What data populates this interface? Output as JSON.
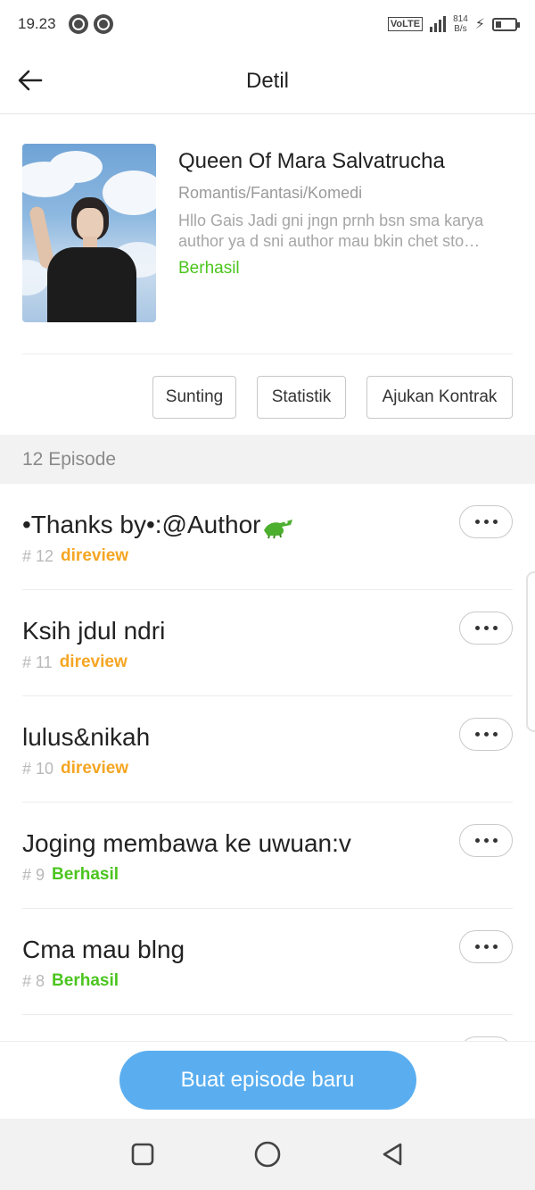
{
  "status_bar": {
    "time": "19.23",
    "network": "VoLTE",
    "network_type": "4G",
    "speed_value": "814",
    "speed_unit": "B/s",
    "icons": [
      "app-notification-icon",
      "chrome-icon",
      "volte-icon",
      "signal-icon",
      "charging-icon",
      "battery-icon"
    ]
  },
  "header": {
    "title": "Detil",
    "back_icon": "arrow-left-icon"
  },
  "book": {
    "title": "Queen Of Mara Salvatrucha",
    "genre": "Romantis/Fantasi/Komedi",
    "description": "Hllo Gais Jadi gni jngn prnh bsn sma karya author ya d sni author mau bkin chet sto…",
    "status": "Berhasil",
    "status_color": "#4cc51f"
  },
  "actions": [
    {
      "label": "Sunting"
    },
    {
      "label": "Statistik"
    },
    {
      "label": "Ajukan Kontrak"
    }
  ],
  "episodes_header": "12 Episode",
  "episodes": [
    {
      "title": "•Thanks by•:@Author",
      "has_emoji": true,
      "number": "# 12",
      "status": "direview",
      "status_color": "#f5a623"
    },
    {
      "title": "Ksih jdul ndri",
      "has_emoji": false,
      "number": "# 11",
      "status": "direview",
      "status_color": "#f5a623"
    },
    {
      "title": "lulus&nikah",
      "has_emoji": false,
      "number": "# 10",
      "status": "direview",
      "status_color": "#f5a623"
    },
    {
      "title": "Joging membawa ke uwuan:v",
      "has_emoji": false,
      "number": "# 9",
      "status": "Berhasil",
      "status_color": "#4cc51f"
    },
    {
      "title": "Cma mau blng",
      "has_emoji": false,
      "number": "# 8",
      "status": "Berhasil",
      "status_color": "#4cc51f"
    }
  ],
  "primary_button": {
    "label": "Buat episode baru",
    "color": "#5aaef0"
  },
  "nav_bar": {
    "icons": [
      "recent-apps-icon",
      "home-icon",
      "back-icon"
    ]
  }
}
